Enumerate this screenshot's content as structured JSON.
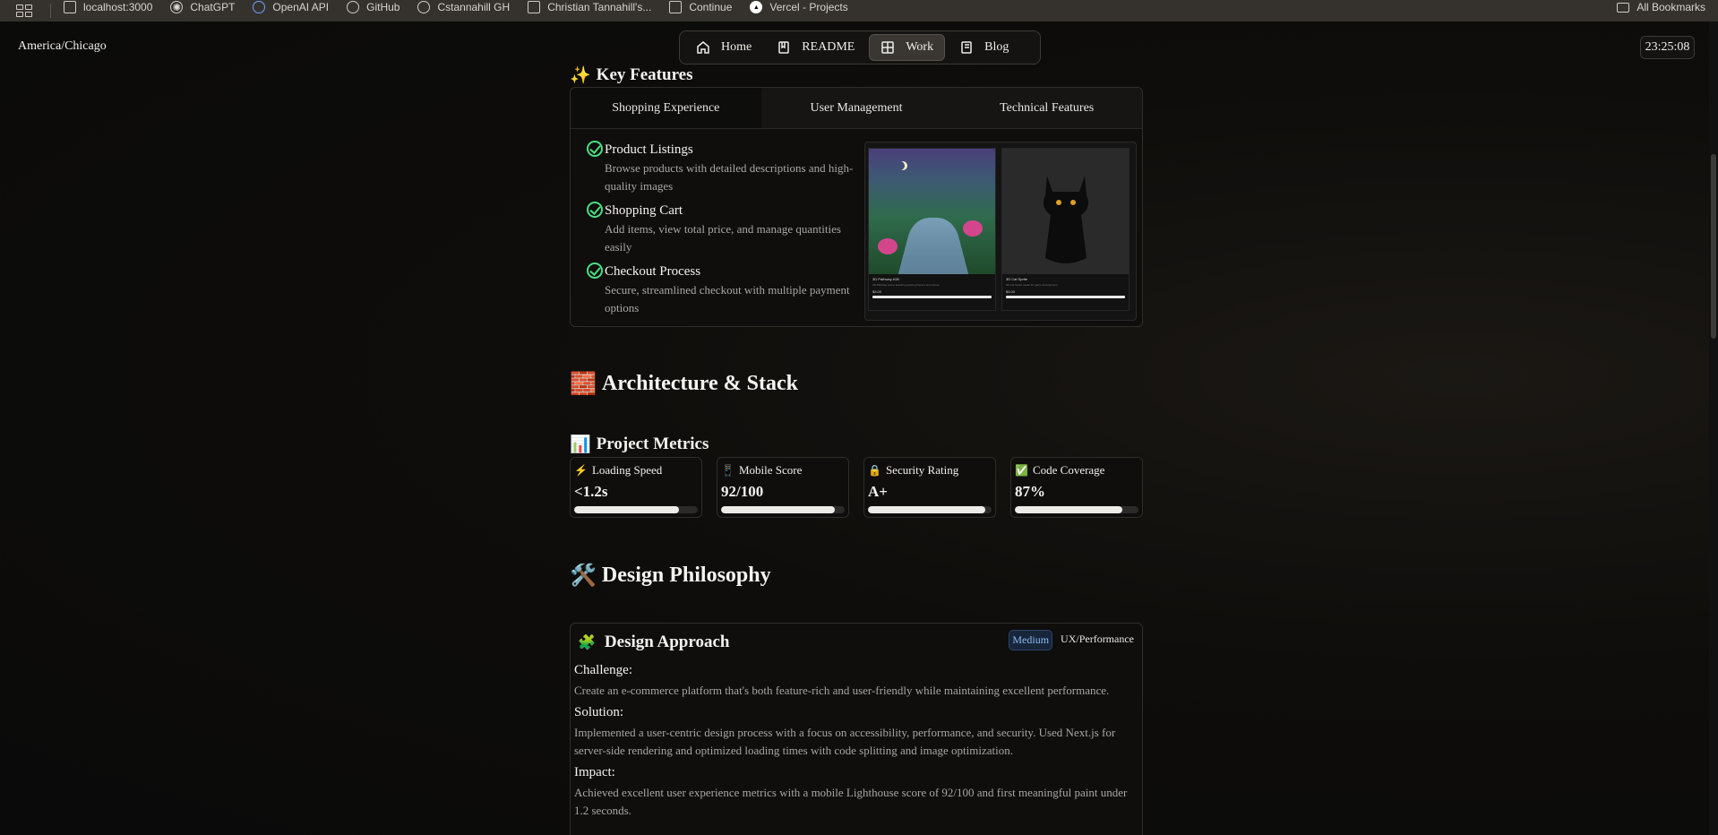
{
  "bookmarks": {
    "items": [
      {
        "label": "localhost:3000",
        "icon": "page-icon"
      },
      {
        "label": "ChatGPT",
        "icon": "openai-icon"
      },
      {
        "label": "OpenAI API",
        "icon": "openai-api-icon"
      },
      {
        "label": "GitHub",
        "icon": "github-icon"
      },
      {
        "label": "Cstannahill GH",
        "icon": "github-icon"
      },
      {
        "label": "Christian Tannahill's...",
        "icon": "page-icon"
      },
      {
        "label": "Continue",
        "icon": "continue-icon"
      },
      {
        "label": "Vercel - Projects",
        "icon": "vercel-icon"
      }
    ],
    "all_label": "All Bookmarks"
  },
  "header": {
    "timezone": "America/Chicago",
    "time": "23:25:08",
    "nav": [
      {
        "label": "Home",
        "icon": "home-icon",
        "active": false
      },
      {
        "label": "README",
        "icon": "book-icon",
        "active": false
      },
      {
        "label": "Work",
        "icon": "grid-icon",
        "active": true
      },
      {
        "label": "Blog",
        "icon": "notebook-icon",
        "active": false
      }
    ]
  },
  "key_features": {
    "emoji": "✨",
    "title": "Key Features",
    "tabs": [
      "Shopping Experience",
      "User Management",
      "Technical Features"
    ],
    "items": [
      {
        "title": "Product Listings",
        "desc": "Browse products with detailed descriptions and high-quality images"
      },
      {
        "title": "Shopping Cart",
        "desc": "Add items, view total price, and manage quantities easily"
      },
      {
        "title": "Checkout Process",
        "desc": "Secure, streamlined checkout with multiple payment options"
      }
    ],
    "preview": [
      {
        "title": "3D Pathway #1B",
        "desc": "3D Pathway scene featuring glowing flowers and stones",
        "price": "$3.00"
      },
      {
        "title": "3D Cat Sprite",
        "desc": "3D Cat Sprite model for game development",
        "price": "$3.00"
      }
    ]
  },
  "architecture": {
    "emoji": "🧱",
    "title": "Architecture & Stack"
  },
  "metrics": {
    "emoji": "📊",
    "title": "Project Metrics",
    "items": [
      {
        "emoji": "⚡",
        "label": "Loading Speed",
        "value": "<1.2s",
        "progress": 0.85
      },
      {
        "emoji": "📱",
        "label": "Mobile Score",
        "value": "92/100",
        "progress": 0.92
      },
      {
        "emoji": "🔒",
        "label": "Security Rating",
        "value": "A+",
        "progress": 0.95
      },
      {
        "emoji": "✅",
        "label": "Code Coverage",
        "value": "87%",
        "progress": 0.87
      }
    ]
  },
  "design": {
    "emoji": "🛠️",
    "title": "Design Philosophy",
    "approach_emoji": "🧩",
    "approach_title": "Design Approach",
    "badges": [
      "Medium",
      "UX/Performance"
    ],
    "challenge_label": "Challenge:",
    "challenge": "Create an e-commerce platform that's both feature-rich and user-friendly while maintaining excellent performance.",
    "solution_label": "Solution:",
    "solution": "Implemented a user-centric design process with a focus on accessibility, performance, and security. Used Next.js for server-side rendering and optimized loading times with code splitting and image optimization.",
    "impact_label": "Impact:",
    "impact": "Achieved excellent user experience metrics with a mobile Lighthouse score of 92/100 and first meaningful paint under 1.2 seconds."
  },
  "colors": {
    "accent_check": "#4ade80",
    "badge_medium": "#8fb8ef"
  }
}
